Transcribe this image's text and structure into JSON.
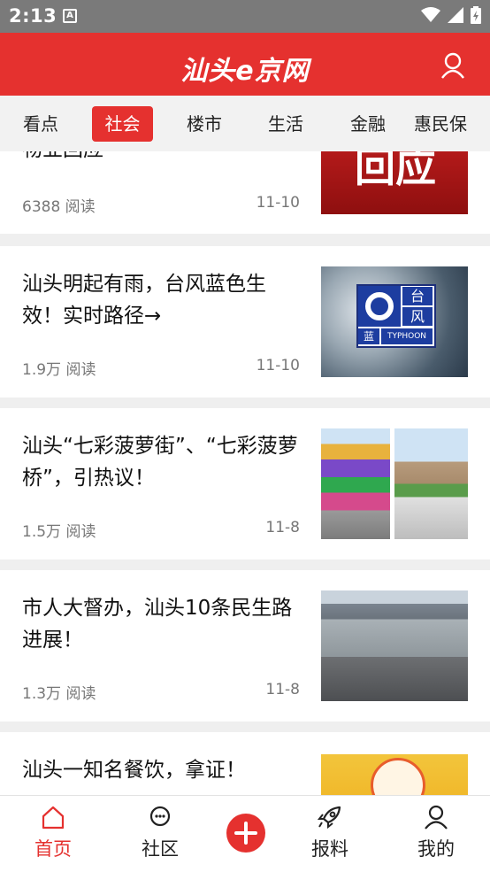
{
  "status_bar": {
    "time": "2:13",
    "notification_glyph": "A"
  },
  "header": {
    "logo": "汕头e京网",
    "user_icon": "user-icon"
  },
  "tabs": [
    {
      "label": "看点",
      "active": false
    },
    {
      "label": "社会",
      "active": true
    },
    {
      "label": "楼市",
      "active": false
    },
    {
      "label": "生活",
      "active": false
    },
    {
      "label": "金融",
      "active": false
    },
    {
      "label": "惠民保",
      "active": false
    }
  ],
  "articles": [
    {
      "title": "物业回应",
      "reads": "6388 阅读",
      "date": "11-10",
      "thumb_text": "回应"
    },
    {
      "title": "汕头明起有雨，台风蓝色生效！实时路径→",
      "reads": "1.9万 阅读",
      "date": "11-10",
      "badge_top": "台",
      "badge_mid": "风",
      "badge_level": "蓝",
      "badge_en": "TYPHOON"
    },
    {
      "title": "汕头“七彩菠萝街”、“七彩菠萝桥”，引热议！",
      "reads": "1.5万 阅读",
      "date": "11-8"
    },
    {
      "title": "市人大督办，汕头10条民生路进展！",
      "reads": "1.3万 阅读",
      "date": "11-8"
    },
    {
      "title": "汕头一知名餐饮，拿证！",
      "reads": "",
      "date": ""
    }
  ],
  "bottom_nav": [
    {
      "label": "首页",
      "icon": "home-icon",
      "active": true
    },
    {
      "label": "社区",
      "icon": "chat-icon",
      "active": false
    },
    {
      "label": "",
      "icon": "plus-icon",
      "active": false
    },
    {
      "label": "报料",
      "icon": "rocket-icon",
      "active": false
    },
    {
      "label": "我的",
      "icon": "user-icon",
      "active": false
    }
  ],
  "colors": {
    "brand": "#e5312f",
    "status_bar": "#7a7a7a"
  }
}
